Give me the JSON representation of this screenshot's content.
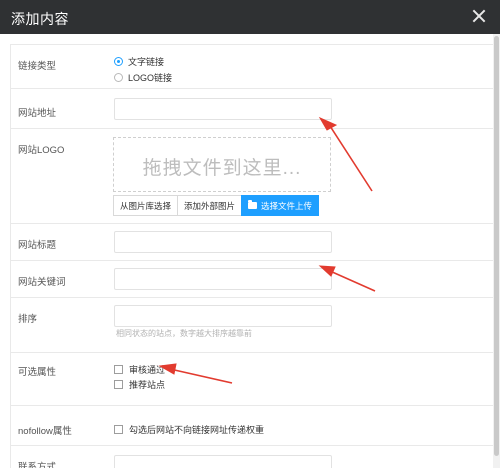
{
  "dialog": {
    "title": "添加内容"
  },
  "fields": {
    "link_type": {
      "label": "链接类型",
      "options": [
        {
          "label": "文字链接",
          "selected": true
        },
        {
          "label": "LOGO链接",
          "selected": false
        }
      ]
    },
    "site_url": {
      "label": "网站地址",
      "value": ""
    },
    "site_logo": {
      "label": "网站LOGO",
      "drop_text": "拖拽文件到这里...",
      "buttons": [
        "从图片库选择",
        "添加外部图片",
        "选择文件上传"
      ]
    },
    "site_title": {
      "label": "网站标题",
      "value": ""
    },
    "site_keywords": {
      "label": "网站关键词",
      "value": ""
    },
    "sort": {
      "label": "排序",
      "value": "",
      "hint": "相同状态的站点，数字越大排序越靠前"
    },
    "optional_attrs": {
      "label": "可选属性",
      "options": [
        {
          "label": "审核通过",
          "checked": false
        },
        {
          "label": "推荐站点",
          "checked": false
        }
      ]
    },
    "nofollow": {
      "label": "nofollow属性",
      "option": "勾选后网站不向链接网址传递权重",
      "checked": false
    },
    "contact": {
      "label": "联系方式",
      "value": ""
    }
  },
  "colors": {
    "accent": "#1e9fff",
    "annotation_arrow": "#e23b2f",
    "titlebar": "#2f3133"
  }
}
